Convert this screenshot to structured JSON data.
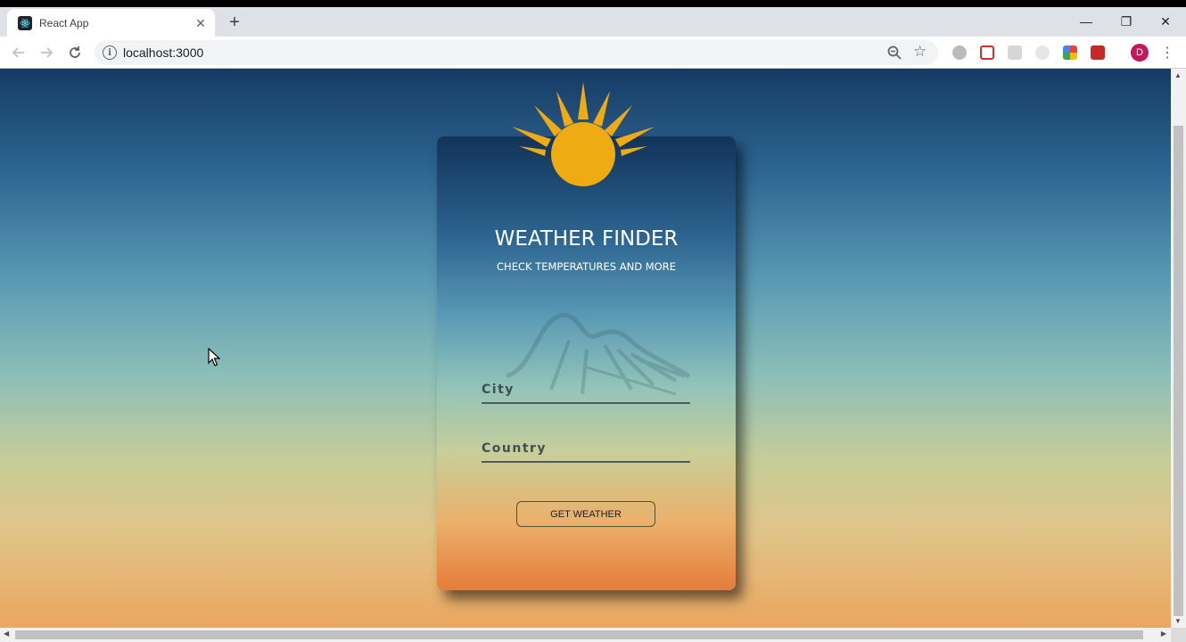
{
  "browser": {
    "tab_title": "React App",
    "tab_close": "✕",
    "new_tab": "+",
    "url": "localhost:3000",
    "window_controls": {
      "minimize": "—",
      "restore": "❐",
      "close": "✕"
    },
    "profile_initial": "D",
    "menu": "⋮",
    "icons": [
      "back-icon",
      "forward-icon",
      "reload-icon",
      "info-icon",
      "zoom-icon",
      "star-icon"
    ]
  },
  "app": {
    "title": "WEATHER FINDER",
    "subtitle": "CHECK TEMPERATURES AND MORE",
    "city_placeholder": "City",
    "country_placeholder": "Country",
    "button_label": "GET WEATHER"
  },
  "colors": {
    "sun": "#eeab12",
    "profile": "#c2185b"
  }
}
